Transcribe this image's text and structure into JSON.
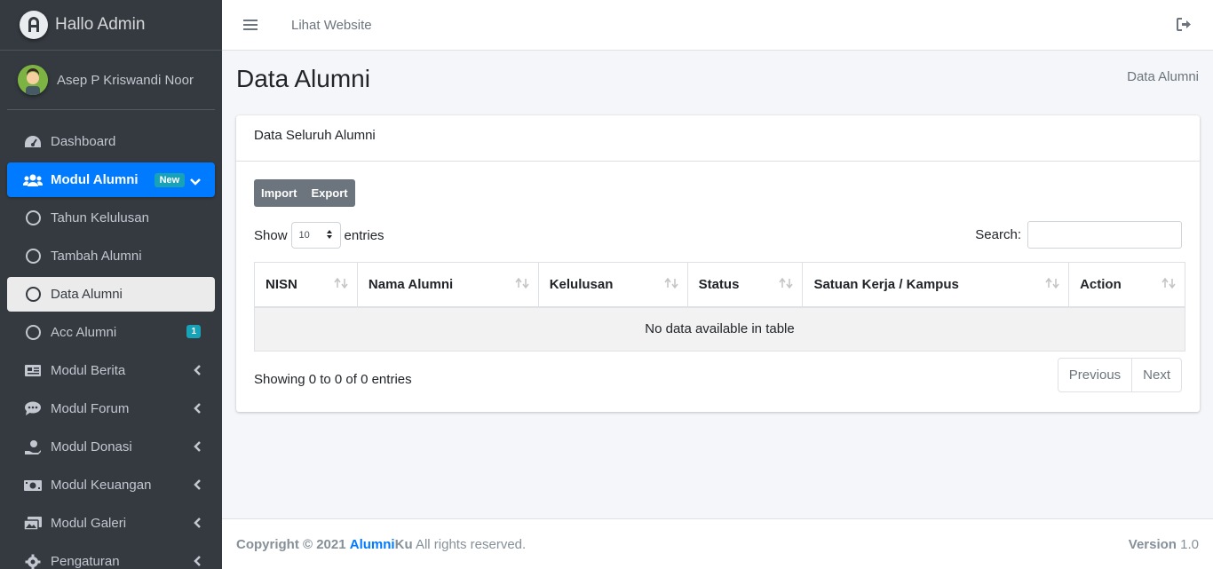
{
  "brand": {
    "title": "Hallo Admin"
  },
  "user": {
    "name": "Asep P Kriswandi Noor"
  },
  "sidebar": {
    "items": [
      {
        "label": "Dashboard"
      },
      {
        "label": "Modul Alumni",
        "badge": "New"
      },
      {
        "label": "Tahun Kelulusan"
      },
      {
        "label": "Tambah Alumni"
      },
      {
        "label": "Data Alumni"
      },
      {
        "label": "Acc Alumni",
        "badge": "1"
      },
      {
        "label": "Modul Berita"
      },
      {
        "label": "Modul Forum"
      },
      {
        "label": "Modul Donasi"
      },
      {
        "label": "Modul Keuangan"
      },
      {
        "label": "Modul Galeri"
      },
      {
        "label": "Pengaturan"
      }
    ]
  },
  "topbar": {
    "link": "Lihat Website"
  },
  "page": {
    "title": "Data Alumni",
    "breadcrumb": "Data Alumni"
  },
  "card": {
    "header": "Data Seluruh Alumni",
    "import_label": "Import",
    "export_label": "Export",
    "show_label": "Show",
    "entries_value": "10",
    "entries_label": "entries",
    "search_label": "Search:",
    "columns": [
      "NISN",
      "Nama Alumni",
      "Kelulusan",
      "Status",
      "Satuan Kerja / Kampus",
      "Action"
    ],
    "empty_text": "No data available in table",
    "info": "Showing 0 to 0 of 0 entries",
    "prev_label": "Previous",
    "next_label": "Next"
  },
  "footer": {
    "copyright": "Copyright © 2021",
    "brand_a": "Alumni",
    "brand_b": "Ku",
    "rights": "All rights reserved.",
    "version_label": "Version",
    "version": "1.0"
  },
  "colors": {
    "primary": "#007bff",
    "sidebar": "#343a40",
    "info": "#17a2b8"
  }
}
